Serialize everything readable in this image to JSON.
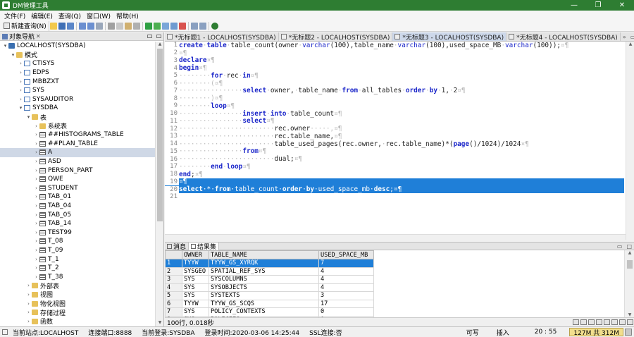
{
  "window": {
    "title": "DM管理工具",
    "controls": [
      "—",
      "❐",
      "✕"
    ]
  },
  "menu": [
    "文件(F)",
    "编辑(E)",
    "查询(Q)",
    "窗口(W)",
    "帮助(H)"
  ],
  "toolbar": {
    "new_query": "新建查询(N)"
  },
  "navigator": {
    "title": "对象导航",
    "tree": [
      {
        "label": "LOCALHOST(SYSDBA)",
        "level": 0,
        "toggle": "▾",
        "icon": "db"
      },
      {
        "label": "模式",
        "level": 1,
        "toggle": "▾",
        "icon": "folder"
      },
      {
        "label": "CTISYS",
        "level": 2,
        "toggle": "›",
        "icon": "schema"
      },
      {
        "label": "EDPS",
        "level": 2,
        "toggle": "›",
        "icon": "schema"
      },
      {
        "label": "MBBZXT",
        "level": 2,
        "toggle": "›",
        "icon": "schema"
      },
      {
        "label": "SYS",
        "level": 2,
        "toggle": "›",
        "icon": "schema"
      },
      {
        "label": "SYSAUDITOR",
        "level": 2,
        "toggle": "›",
        "icon": "schema"
      },
      {
        "label": "SYSDBA",
        "level": 2,
        "toggle": "▾",
        "icon": "schema"
      },
      {
        "label": "表",
        "level": 3,
        "toggle": "▾",
        "icon": "folder"
      },
      {
        "label": "系统表",
        "level": 4,
        "toggle": "›",
        "icon": "folder"
      },
      {
        "label": "##HISTOGRAMS_TABLE",
        "level": 4,
        "toggle": "›",
        "icon": "table"
      },
      {
        "label": "##PLAN_TABLE",
        "level": 4,
        "toggle": "›",
        "icon": "table"
      },
      {
        "label": "A",
        "level": 4,
        "toggle": "›",
        "icon": "table",
        "selected": true
      },
      {
        "label": "ASD",
        "level": 4,
        "toggle": "›",
        "icon": "table"
      },
      {
        "label": "PERSON_PART",
        "level": 4,
        "toggle": "›",
        "icon": "table"
      },
      {
        "label": "QWE",
        "level": 4,
        "toggle": "›",
        "icon": "table"
      },
      {
        "label": "STUDENT",
        "level": 4,
        "toggle": "›",
        "icon": "table"
      },
      {
        "label": "TAB_01",
        "level": 4,
        "toggle": "›",
        "icon": "table"
      },
      {
        "label": "TAB_04",
        "level": 4,
        "toggle": "›",
        "icon": "table"
      },
      {
        "label": "TAB_05",
        "level": 4,
        "toggle": "›",
        "icon": "table"
      },
      {
        "label": "TAB_14",
        "level": 4,
        "toggle": "›",
        "icon": "table"
      },
      {
        "label": "TEST99",
        "level": 4,
        "toggle": "›",
        "icon": "table"
      },
      {
        "label": "T_08",
        "level": 4,
        "toggle": "›",
        "icon": "table"
      },
      {
        "label": "T_09",
        "level": 4,
        "toggle": "›",
        "icon": "table"
      },
      {
        "label": "T_1",
        "level": 4,
        "toggle": "›",
        "icon": "table"
      },
      {
        "label": "T_2",
        "level": 4,
        "toggle": "›",
        "icon": "table"
      },
      {
        "label": "T_38",
        "level": 4,
        "toggle": "›",
        "icon": "table"
      },
      {
        "label": "外部表",
        "level": 3,
        "toggle": "›",
        "icon": "folder"
      },
      {
        "label": "视图",
        "level": 3,
        "toggle": "›",
        "icon": "folder"
      },
      {
        "label": "物化视图",
        "level": 3,
        "toggle": "›",
        "icon": "folder"
      },
      {
        "label": "存储过程",
        "level": 3,
        "toggle": "›",
        "icon": "folder"
      },
      {
        "label": "函数",
        "level": 3,
        "toggle": "›",
        "icon": "folder"
      }
    ]
  },
  "editor_tabs": [
    {
      "label": "*无标题1 - LOCALHOST(SYSDBA)",
      "active": false
    },
    {
      "label": "*无标题2 - LOCALHOST(SYSDBA)",
      "active": false
    },
    {
      "label": "*无标题3 - LOCALHOST(SYSDBA)",
      "active": true
    },
    {
      "label": "*无标题4 - LOCALHOST(SYSDBA)",
      "active": false
    }
  ],
  "editor": {
    "lines": [
      {
        "n": "1",
        "tokens": [
          [
            "kw",
            "create"
          ],
          [
            "dot",
            "·"
          ],
          [
            "kw",
            "table"
          ],
          [
            "dot",
            "·"
          ],
          [
            "t",
            "table_count"
          ],
          [
            "t",
            "("
          ],
          [
            "t",
            "owner"
          ],
          [
            "dot",
            "·"
          ],
          [
            "fn",
            "varchar"
          ],
          [
            "t",
            "(100),table_name"
          ],
          [
            "dot",
            "·"
          ],
          [
            "fn",
            "varchar"
          ],
          [
            "t",
            "(100),used_space_MB"
          ],
          [
            "dot",
            "·"
          ],
          [
            "fn",
            "varchar"
          ],
          [
            "t",
            "(100));"
          ],
          [
            "dot",
            "¤¶"
          ]
        ]
      },
      {
        "n": "2",
        "tokens": [
          [
            "dot",
            "¤¶"
          ]
        ]
      },
      {
        "n": "3",
        "tokens": [
          [
            "kw",
            "declare"
          ],
          [
            "dot",
            "¤¶"
          ]
        ]
      },
      {
        "n": "4",
        "tokens": [
          [
            "kw",
            "begin"
          ],
          [
            "dot",
            "¤¶"
          ]
        ]
      },
      {
        "n": "5",
        "tokens": [
          [
            "dot",
            "········"
          ],
          [
            "kw",
            "for"
          ],
          [
            "dot",
            "·"
          ],
          [
            "t",
            "rec"
          ],
          [
            "dot",
            "·"
          ],
          [
            "kw",
            "in"
          ],
          [
            "dot",
            "¤¶"
          ]
        ]
      },
      {
        "n": "6",
        "tokens": [
          [
            "dot",
            "········(¤¶"
          ]
        ]
      },
      {
        "n": "7",
        "tokens": [
          [
            "dot",
            "················"
          ],
          [
            "kw",
            "select"
          ],
          [
            "dot",
            "·"
          ],
          [
            "t",
            "owner,"
          ],
          [
            "dot",
            "·"
          ],
          [
            "t",
            "table_name"
          ],
          [
            "dot",
            "·"
          ],
          [
            "kw",
            "from"
          ],
          [
            "dot",
            "·"
          ],
          [
            "t",
            "all_tables"
          ],
          [
            "dot",
            "·"
          ],
          [
            "kw",
            "order"
          ],
          [
            "dot",
            "·"
          ],
          [
            "kw",
            "by"
          ],
          [
            "dot",
            "·"
          ],
          [
            "t",
            "1,"
          ],
          [
            "dot",
            "·"
          ],
          [
            "t",
            "2"
          ],
          [
            "dot",
            "¤¶"
          ]
        ]
      },
      {
        "n": "8",
        "tokens": [
          [
            "dot",
            "········)¤¶"
          ]
        ]
      },
      {
        "n": "9",
        "tokens": [
          [
            "dot",
            "········"
          ],
          [
            "kw",
            "loop"
          ],
          [
            "dot",
            "¤¶"
          ]
        ]
      },
      {
        "n": "10",
        "tokens": [
          [
            "dot",
            "················"
          ],
          [
            "kw",
            "insert"
          ],
          [
            "dot",
            "·"
          ],
          [
            "kw",
            "into"
          ],
          [
            "dot",
            "·"
          ],
          [
            "t",
            "table_count"
          ],
          [
            "dot",
            "¤¶"
          ]
        ]
      },
      {
        "n": "11",
        "tokens": [
          [
            "dot",
            "················"
          ],
          [
            "kw",
            "select"
          ],
          [
            "dot",
            "¤¶"
          ]
        ]
      },
      {
        "n": "12",
        "tokens": [
          [
            "dot",
            "························"
          ],
          [
            "t",
            "rec.owner"
          ],
          [
            "dot",
            "·····,¤¶"
          ]
        ]
      },
      {
        "n": "13",
        "tokens": [
          [
            "dot",
            "························"
          ],
          [
            "t",
            "rec.table_name,"
          ],
          [
            "dot",
            "¤¶"
          ]
        ]
      },
      {
        "n": "14",
        "tokens": [
          [
            "dot",
            "························"
          ],
          [
            "t",
            "table_used_pages(rec.owner,"
          ],
          [
            "dot",
            "·"
          ],
          [
            "t",
            "rec.table_name)*("
          ],
          [
            "kw",
            "page"
          ],
          [
            "t",
            "()/1024)/1024"
          ],
          [
            "dot",
            "¤¶"
          ]
        ]
      },
      {
        "n": "15",
        "tokens": [
          [
            "dot",
            "················"
          ],
          [
            "kw",
            "from"
          ],
          [
            "dot",
            "¤¶"
          ]
        ]
      },
      {
        "n": "16",
        "tokens": [
          [
            "dot",
            "························"
          ],
          [
            "t",
            "dual;"
          ],
          [
            "dot",
            "¤¶"
          ]
        ]
      },
      {
        "n": "17",
        "tokens": [
          [
            "dot",
            "········"
          ],
          [
            "kw",
            "end"
          ],
          [
            "dot",
            "·"
          ],
          [
            "kw",
            "loop"
          ],
          [
            "dot",
            "¤¶"
          ]
        ]
      },
      {
        "n": "18",
        "tokens": [
          [
            "kw",
            "end"
          ],
          [
            "t",
            ";"
          ],
          [
            "dot",
            "¤¶"
          ]
        ]
      },
      {
        "n": "19",
        "tokens": [
          [
            "dot",
            "¤¶"
          ]
        ],
        "highlight": true
      },
      {
        "n": "20",
        "tokens": [
          [
            "kw",
            "select"
          ],
          [
            "dot",
            "·"
          ],
          [
            "t",
            "*"
          ],
          [
            "dot",
            "·"
          ],
          [
            "kw",
            "from"
          ],
          [
            "dot",
            "·"
          ],
          [
            "t",
            "table_count"
          ],
          [
            "dot",
            "·"
          ],
          [
            "kw",
            "order"
          ],
          [
            "dot",
            "·"
          ],
          [
            "kw",
            "by"
          ],
          [
            "dot",
            "·"
          ],
          [
            "t",
            "used_space_mb"
          ],
          [
            "dot",
            "·"
          ],
          [
            "kw",
            "desc"
          ],
          [
            "t",
            ";"
          ],
          [
            "dot",
            "¤¶"
          ]
        ],
        "highlight": true
      },
      {
        "n": "21",
        "tokens": []
      }
    ]
  },
  "results": {
    "tabs": [
      {
        "label": "消息",
        "active": false
      },
      {
        "label": "结果集",
        "active": true
      }
    ],
    "columns": [
      "OWNER",
      "TABLE_NAME",
      "USED_SPACE_MB"
    ],
    "rows": [
      {
        "n": "1",
        "cells": [
          "TYYW",
          "TYYW_GS_XYRQK",
          "7"
        ],
        "selected": true
      },
      {
        "n": "2",
        "cells": [
          "SYSGEO",
          "SPATIAL_REF_SYS",
          "4"
        ]
      },
      {
        "n": "3",
        "cells": [
          "SYS",
          "SYSCOLUMNS",
          "4"
        ]
      },
      {
        "n": "4",
        "cells": [
          "SYS",
          "SYSOBJECTS",
          "4"
        ]
      },
      {
        "n": "5",
        "cells": [
          "SYS",
          "SYSTEXTS",
          "3"
        ]
      },
      {
        "n": "6",
        "cells": [
          "TYYW",
          "TYYW_GS_SCQS",
          "17"
        ]
      },
      {
        "n": "7",
        "cells": [
          "SYS",
          "POLICY_CONTEXTS",
          "0"
        ]
      },
      {
        "n": "8",
        "cells": [
          "SYS",
          "POLICIES",
          "0"
        ]
      }
    ],
    "summary": "100行, 0.018秒"
  },
  "status": {
    "site": "当前站点:LOCALHOST",
    "port": "连接端口:8888",
    "login": "当前登录:SYSDBA",
    "login_time": "登录时间:2020-03-06 14:25:44",
    "ssl": "SSL连接:否",
    "mode": "可写",
    "insert": "插入",
    "cursor": "20 : 55",
    "memory": "127M 共 312M"
  }
}
